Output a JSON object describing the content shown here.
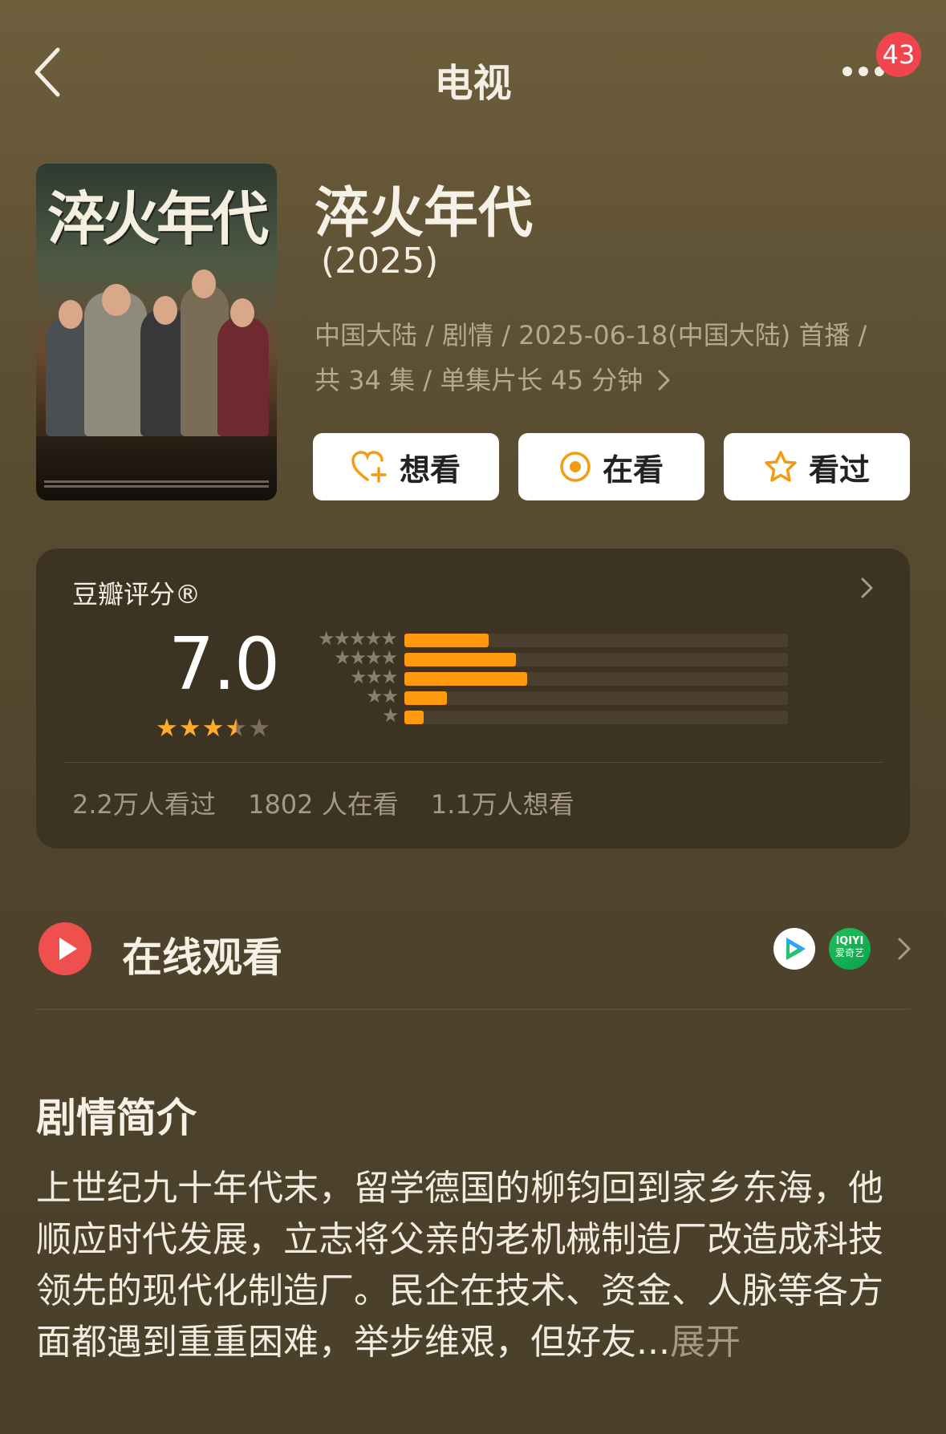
{
  "header": {
    "title": "电视",
    "notification_count": "43"
  },
  "poster": {
    "title_text": "淬火年代"
  },
  "item": {
    "title": "淬火年代",
    "year": "(2025)",
    "meta_line1": "中国大陆 / 剧情 / 2025-06-18(中国大陆) 首播 /",
    "meta_line2": "共 34 集 / 单集片长 45 分钟"
  },
  "actions": {
    "want": "想看",
    "watching": "在看",
    "watched": "看过"
  },
  "rating": {
    "label": "豆瓣评分®",
    "score": "7.0",
    "stars": 3.5,
    "distribution": [
      {
        "stars": 5,
        "fraction": 0.22
      },
      {
        "stars": 4,
        "fraction": 0.29
      },
      {
        "stars": 3,
        "fraction": 0.32
      },
      {
        "stars": 2,
        "fraction": 0.11
      },
      {
        "stars": 1,
        "fraction": 0.05
      }
    ],
    "watched_count": "2.2万人看过",
    "watching_count": "1802 人在看",
    "want_count": "1.1万人想看"
  },
  "watch": {
    "label": "在线观看",
    "platforms": [
      "tencent-video-icon",
      "iqiyi-icon"
    ],
    "iqiyi_text_top": "iQIYI",
    "iqiyi_text_bottom": "爱奇艺"
  },
  "synopsis": {
    "title": "剧情简介",
    "text": "上世纪九十年代末，留学德国的柳钧回到家乡东海，他顺应时代发展，立志将父亲的老机械制造厂改造成科技领先的现代化制造厂。民企在技术、资金、人脉等各方面都遇到重重困难，举步维艰，但好友...",
    "expand": "展开"
  },
  "colors": {
    "accent": "#ff9a10",
    "star": "#ffac2d",
    "badge": "#f0454e",
    "play": "#f0504d"
  }
}
